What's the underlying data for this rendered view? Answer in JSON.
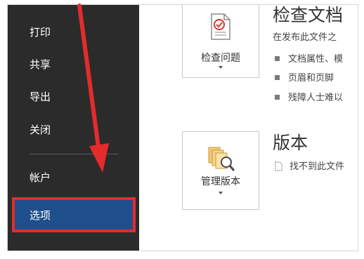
{
  "sidebar": {
    "items": [
      {
        "label": "打印"
      },
      {
        "label": "共享"
      },
      {
        "label": "导出"
      },
      {
        "label": "关闭"
      },
      {
        "label": "帐户"
      },
      {
        "label": "选项"
      }
    ]
  },
  "inspect": {
    "button_label": "检查问题",
    "title": "检查文档",
    "description": "在发布此文件之",
    "bullets": [
      "文档属性、模",
      "页眉和页脚",
      "残障人士难以"
    ]
  },
  "versions": {
    "button_label": "管理版本",
    "title": "版本",
    "description": "找不到此文件"
  },
  "colors": {
    "sidebar_bg": "#2b2b2b",
    "selected_bg": "#1f4e8c",
    "annotation_red": "#e52b2b"
  }
}
